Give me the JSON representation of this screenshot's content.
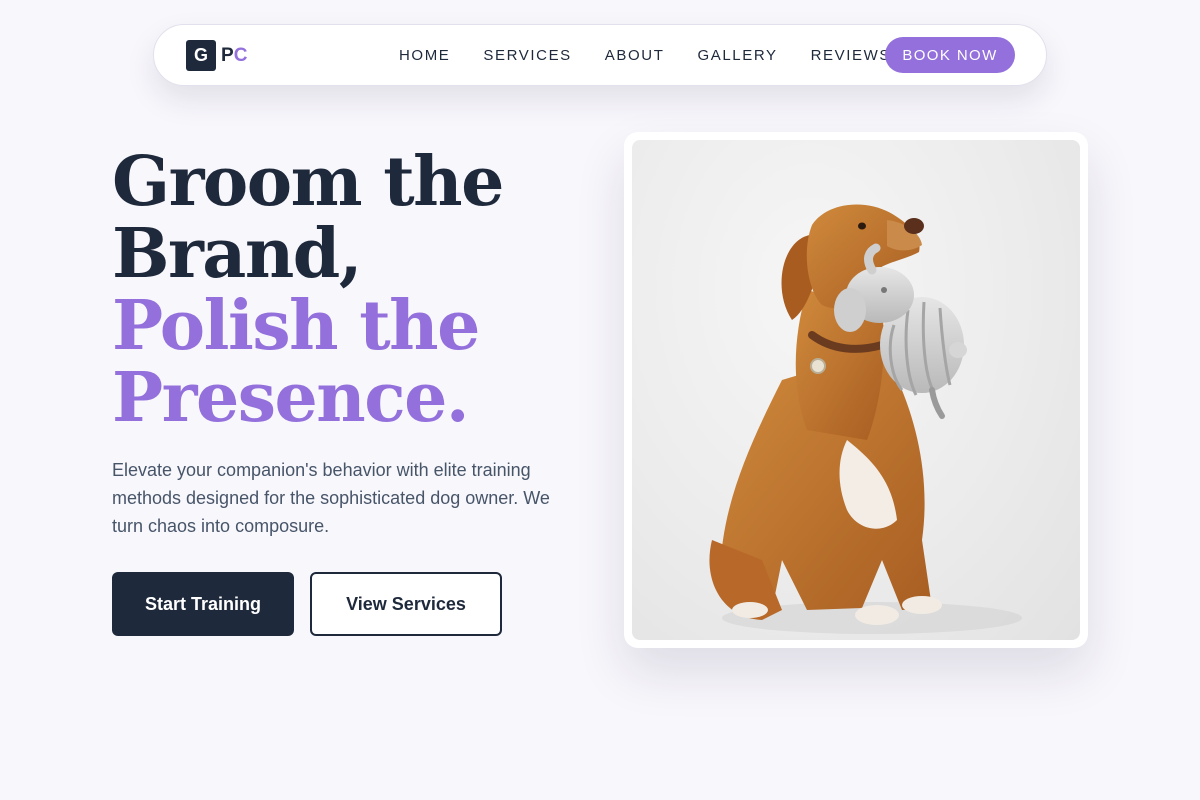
{
  "nav": {
    "logo_mark": "G",
    "logo_p": "P",
    "logo_c": "C",
    "links": [
      "HOME",
      "SERVICES",
      "ABOUT",
      "GALLERY",
      "REVIEWS"
    ],
    "cta": "BOOK NOW"
  },
  "hero": {
    "headline_line1": "Groom the",
    "headline_line2": "Brand,",
    "headline_line3": "Polish the",
    "headline_line4": "Presence.",
    "lead": "Elevate your companion's behavior with elite training methods designed for the sophisticated dog owner. We turn chaos into composure.",
    "primary_button": "Start Training",
    "secondary_button": "View Services"
  },
  "image": {
    "subject": "dog-with-toy"
  },
  "colors": {
    "accent": "#9370db",
    "dark": "#1e293b",
    "background": "#f8f7fc",
    "body_text": "#475569"
  }
}
